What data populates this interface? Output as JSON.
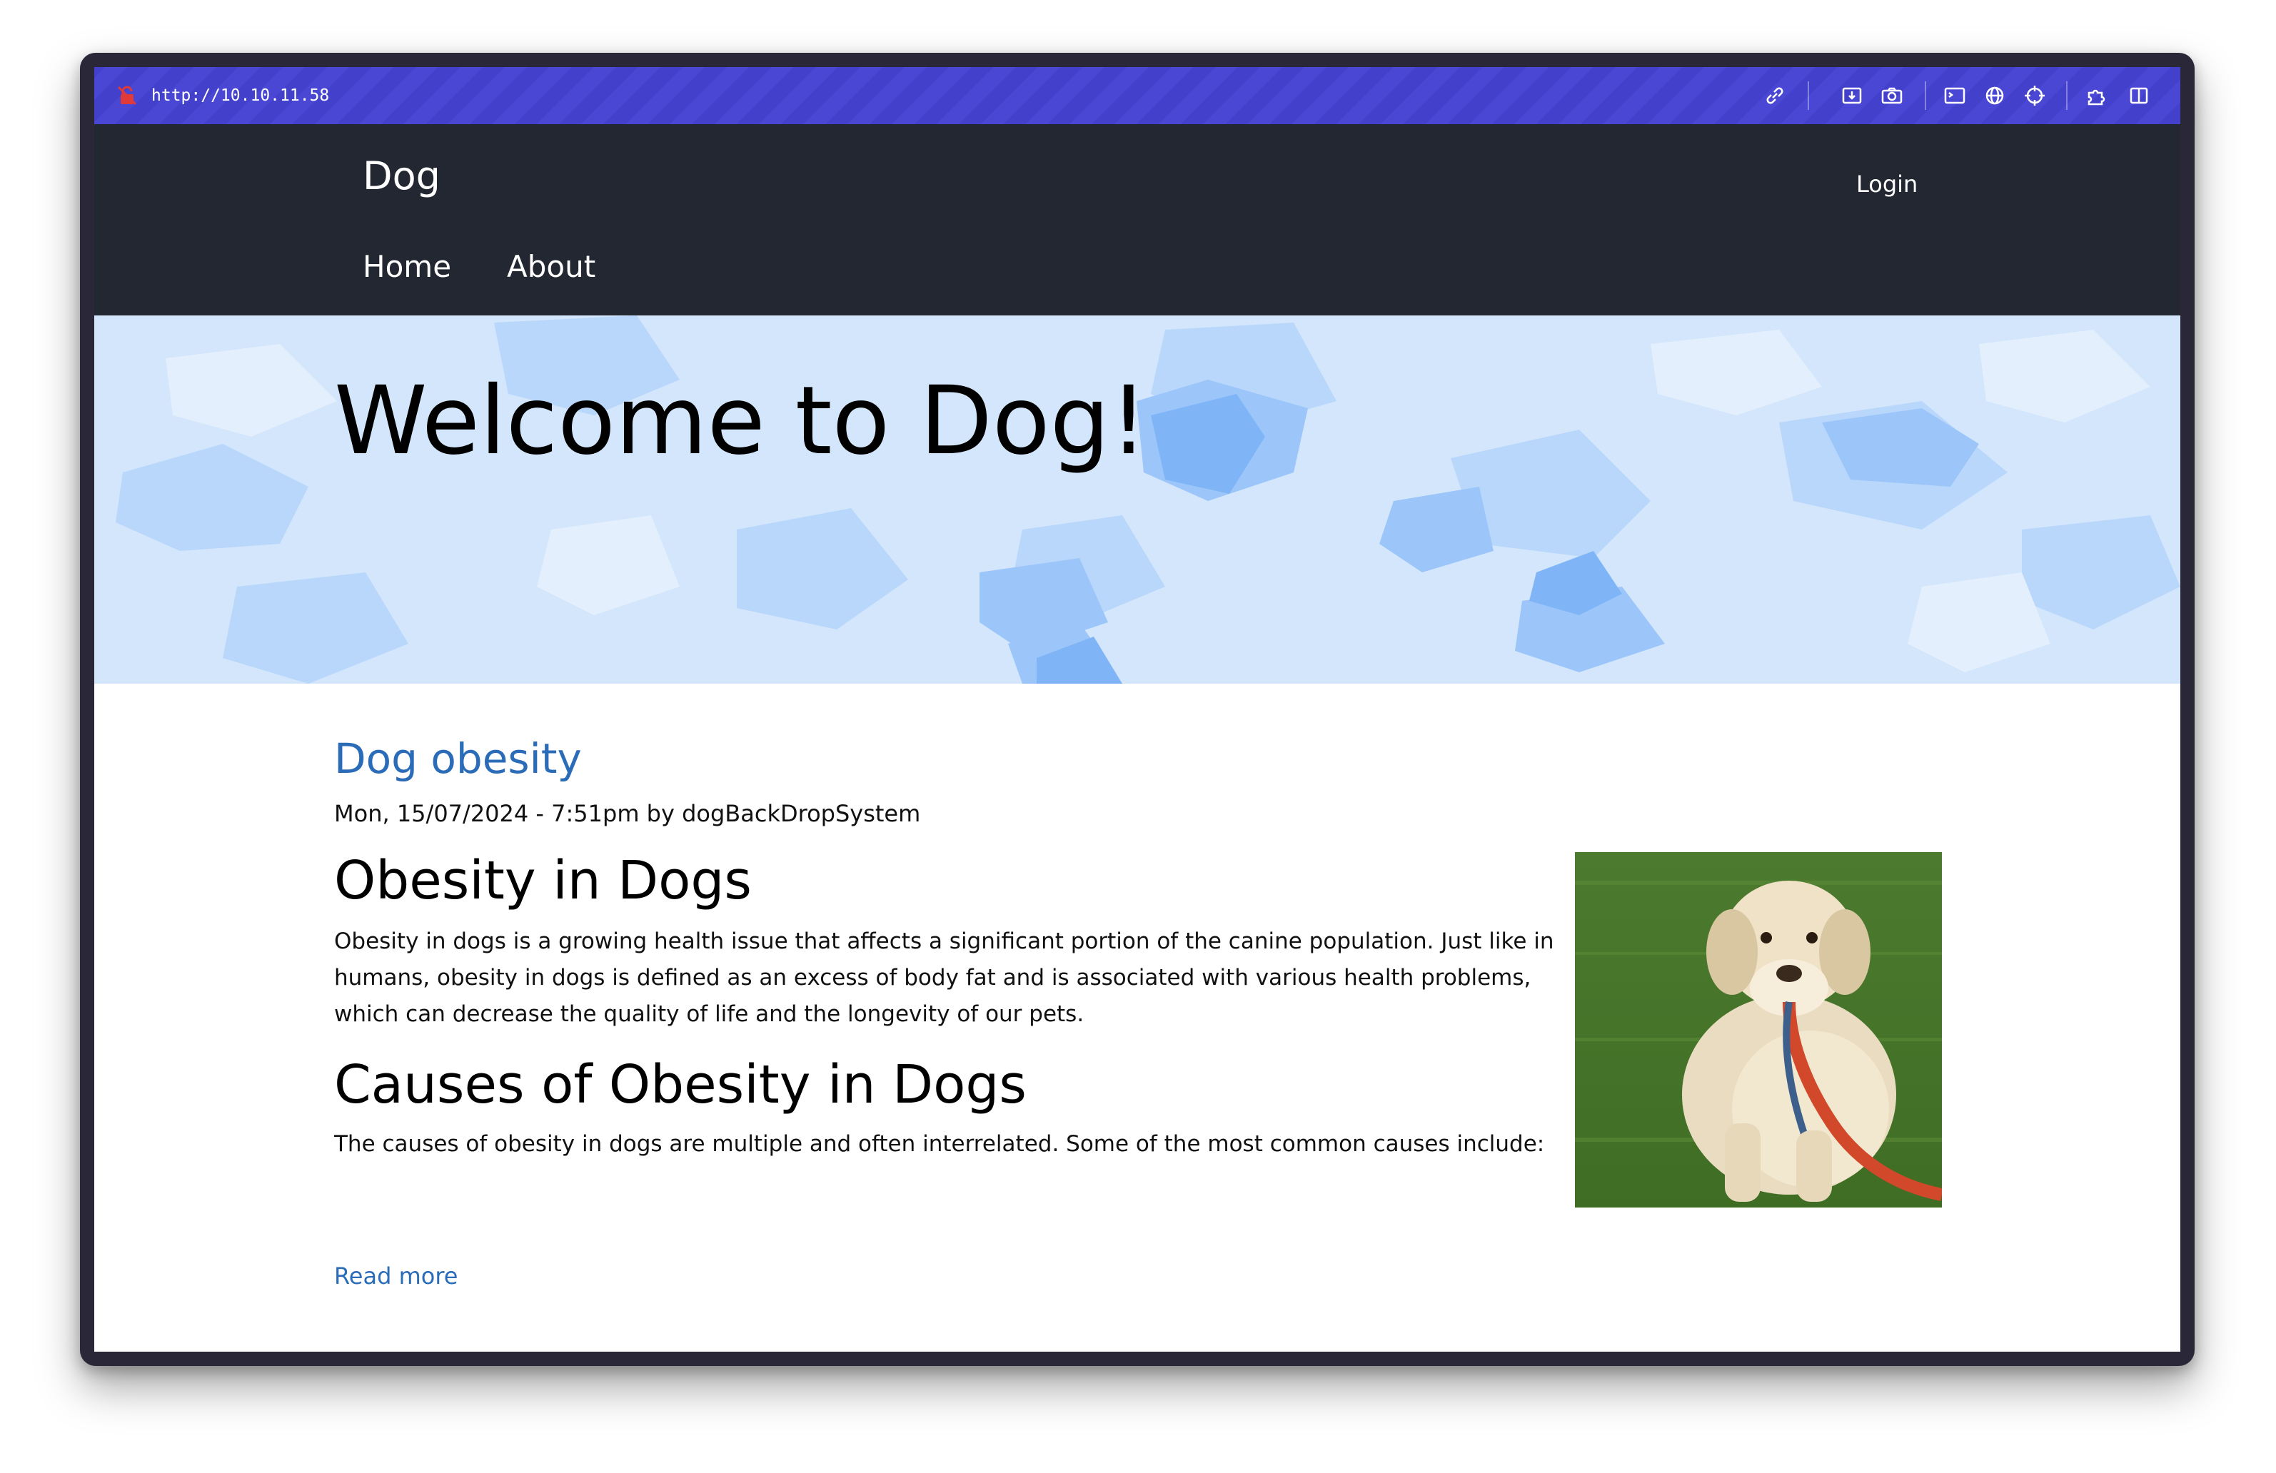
{
  "browser": {
    "url": "http://10.10.11.58",
    "icons": [
      "lock-off-icon",
      "link-icon",
      "download-icon",
      "camera-icon",
      "terminal-icon",
      "globe-icon",
      "crosshair-icon",
      "puzzle-icon",
      "split-view-icon"
    ]
  },
  "site": {
    "brand": "Dog",
    "login_label": "Login",
    "nav": [
      {
        "label": "Home"
      },
      {
        "label": "About"
      }
    ]
  },
  "hero": {
    "title": "Welcome to Dog!"
  },
  "article": {
    "title": "Dog obesity",
    "meta": "Mon, 15/07/2024 - 7:51pm by dogBackDropSystem",
    "heading1": "Obesity in Dogs",
    "paragraph1": "Obesity in dogs is a growing health issue that affects a significant portion of the canine population. Just like in humans, obesity in dogs is defined as an excess of body fat and is associated with various health problems, which can decrease the quality of life and the longevity of our pets.",
    "heading2": "Causes of Obesity in Dogs",
    "paragraph2": "The causes of obesity in dogs are multiple and often interrelated. Some of the most common causes include:",
    "read_more": "Read more"
  },
  "colors": {
    "browser_bar": "#4340cc",
    "header_bg": "#222731",
    "link": "#2b6cb8",
    "hero_bg": "#cfe3fb"
  }
}
